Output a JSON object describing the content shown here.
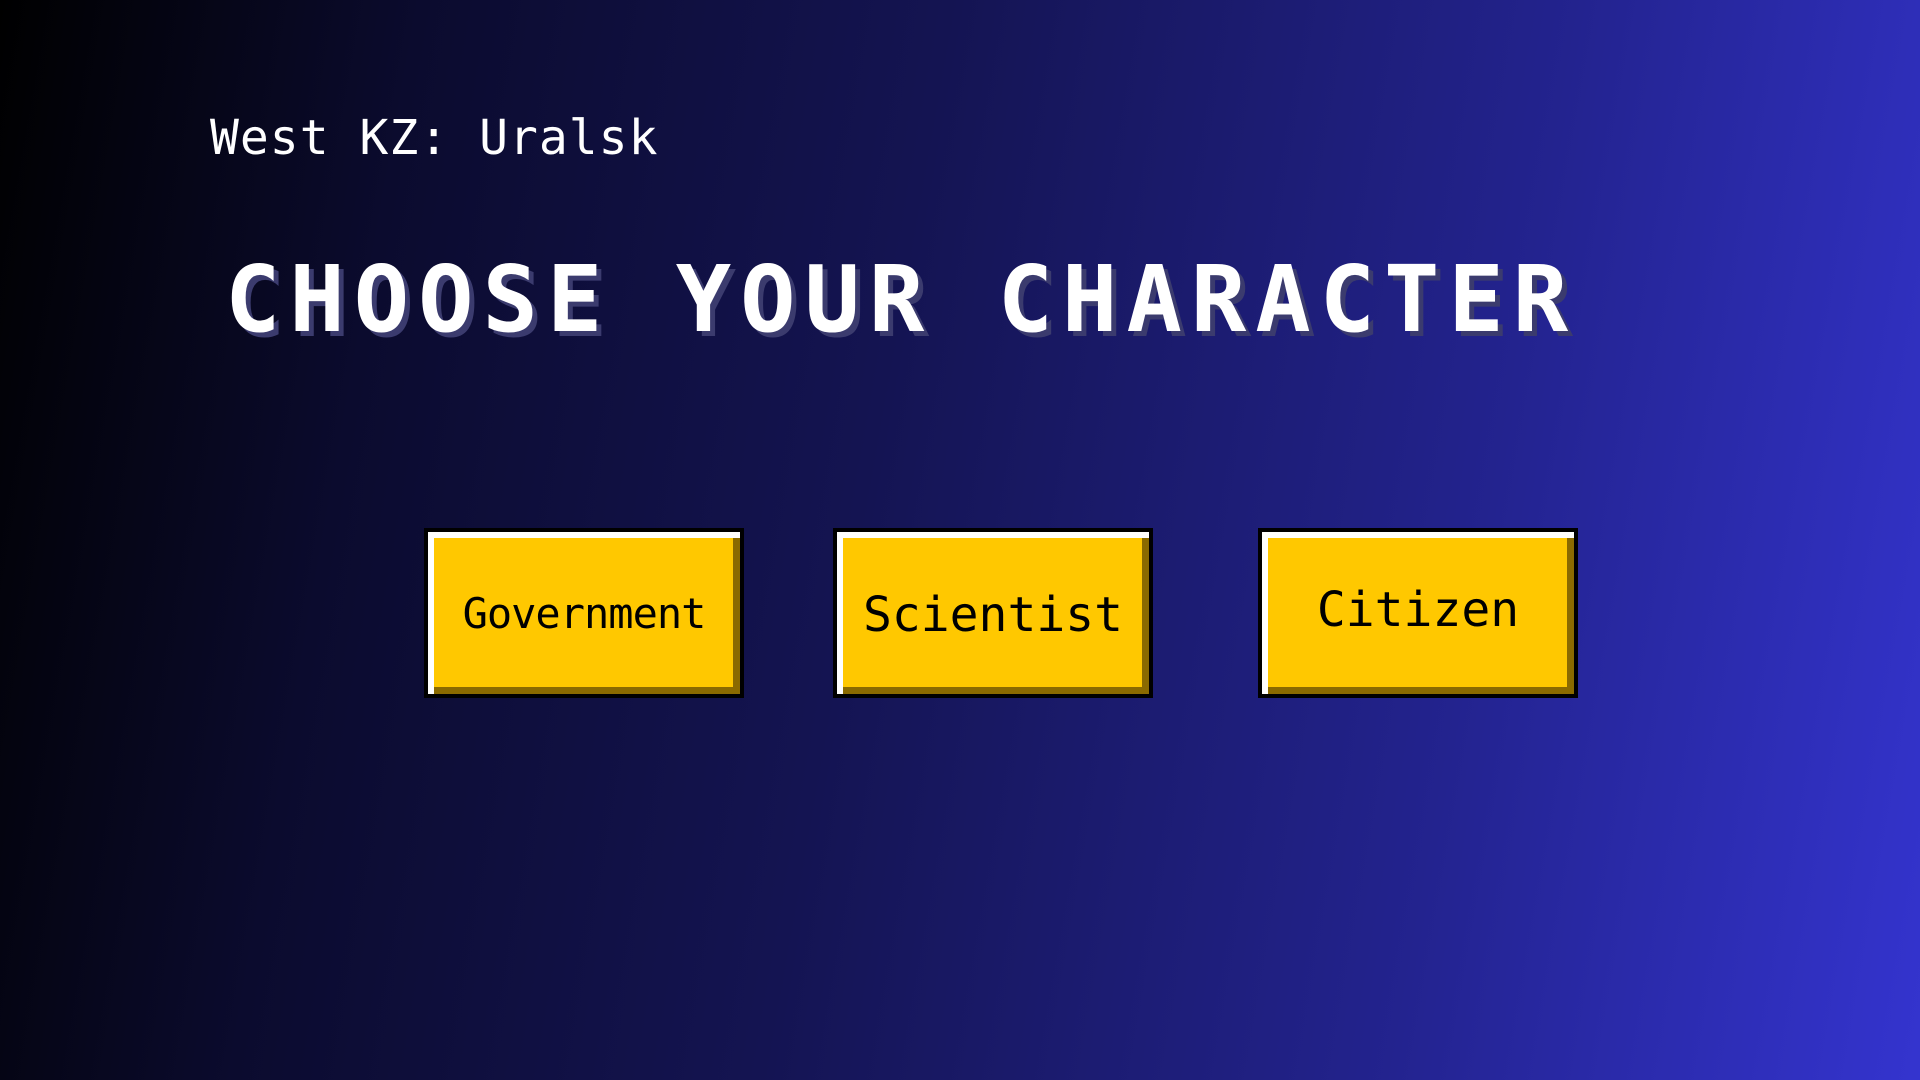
{
  "header": {
    "location": "West KZ: Uralsk",
    "title": "Choose your character"
  },
  "choices": [
    {
      "label": "Government"
    },
    {
      "label": "Scientist"
    },
    {
      "label": "Citizen"
    }
  ],
  "colors": {
    "button_fill": "#ffc800",
    "button_text": "#000000",
    "title_text": "#ffffff",
    "background_start": "#000000",
    "background_end": "#3434cf"
  }
}
